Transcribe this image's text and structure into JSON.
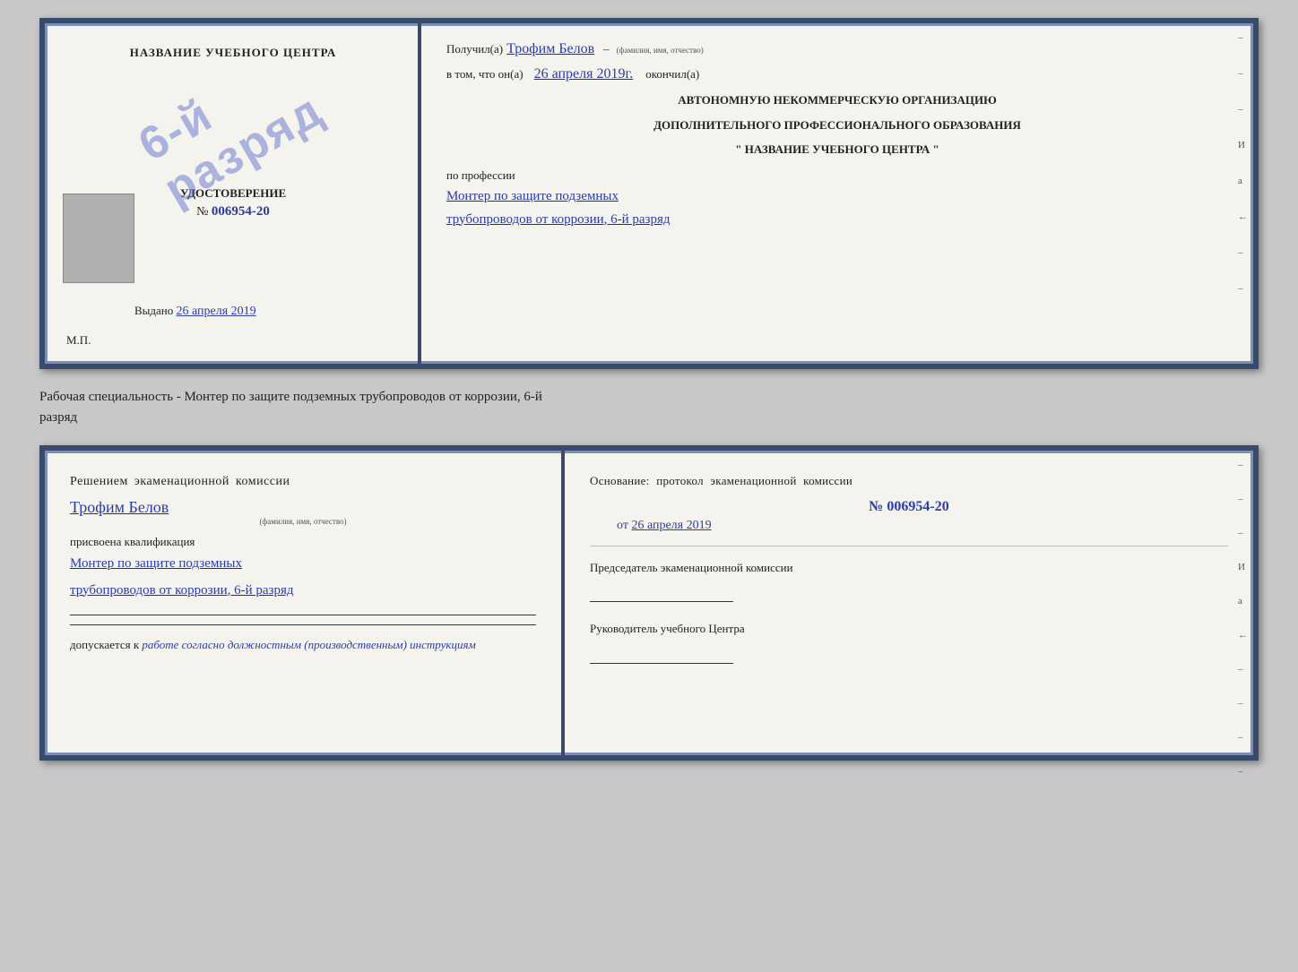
{
  "topCert": {
    "left": {
      "schoolName": "НАЗВАНИЕ УЧЕБНОГО ЦЕНТРА",
      "stampLine1": "6-й",
      "stampLine2": "разряд",
      "docType": "УДОСТОВЕРЕНИЕ",
      "numberLabel": "№",
      "numberValue": "006954-20",
      "issuedLabel": "Выдано",
      "issuedDate": "26 апреля 2019",
      "mpLabel": "М.П."
    },
    "right": {
      "receivedLabel": "Получил(а)",
      "receivedName": "Трофим Белов",
      "fioHint": "(фамилия, имя, отчество)",
      "dashSymbol": "–",
      "inThatLabel": "в том, что он(а)",
      "completedDate": "26 апреля 2019г.",
      "completedLabel": "окончил(а)",
      "orgLine1": "АВТОНОМНУЮ НЕКОММЕРЧЕСКУЮ ОРГАНИЗАЦИЮ",
      "orgLine2": "ДОПОЛНИТЕЛЬНОГО ПРОФЕССИОНАЛЬНОГО ОБРАЗОВАНИЯ",
      "orgLine3": "\"   НАЗВАНИЕ УЧЕБНОГО ЦЕНТРА   \"",
      "professionLabel": "по профессии",
      "professionLine1": "Монтер по защите подземных",
      "professionLine2": "трубопроводов от коррозии, 6-й разряд",
      "dashes": [
        "-",
        "-",
        "-",
        "И",
        "а",
        "←",
        "-",
        "-",
        "-",
        "-",
        "-"
      ]
    }
  },
  "middleText": {
    "line1": "Рабочая специальность - Монтер по защите подземных трубопроводов от коррозии, 6-й",
    "line2": "разряд"
  },
  "bottomCert": {
    "left": {
      "heading": "Решением  экаменационной  комиссии",
      "name": "Трофим Белов",
      "fioHint": "(фамилия, имя, отчество)",
      "qualificationLabel": "присвоена квалификация",
      "qualLine1": "Монтер по защите подземных",
      "qualLine2": "трубопроводов от коррозии, 6-й разряд",
      "admitLabel": "допускается к",
      "admitValue": "работе согласно должностным (производственным) инструкциям"
    },
    "right": {
      "heading": "Основание:  протокол  экаменационной  комиссии",
      "numberLabel": "№",
      "numberValue": "006954-20",
      "dateLabel": "от",
      "dateValue": "26 апреля 2019",
      "chairLabel": "Председатель экаменационной комиссии",
      "headLabel": "Руководитель учебного Центра",
      "dashes": [
        "-",
        "-",
        "-",
        "И",
        "а",
        "←",
        "-",
        "-",
        "-",
        "-",
        "-"
      ]
    }
  }
}
